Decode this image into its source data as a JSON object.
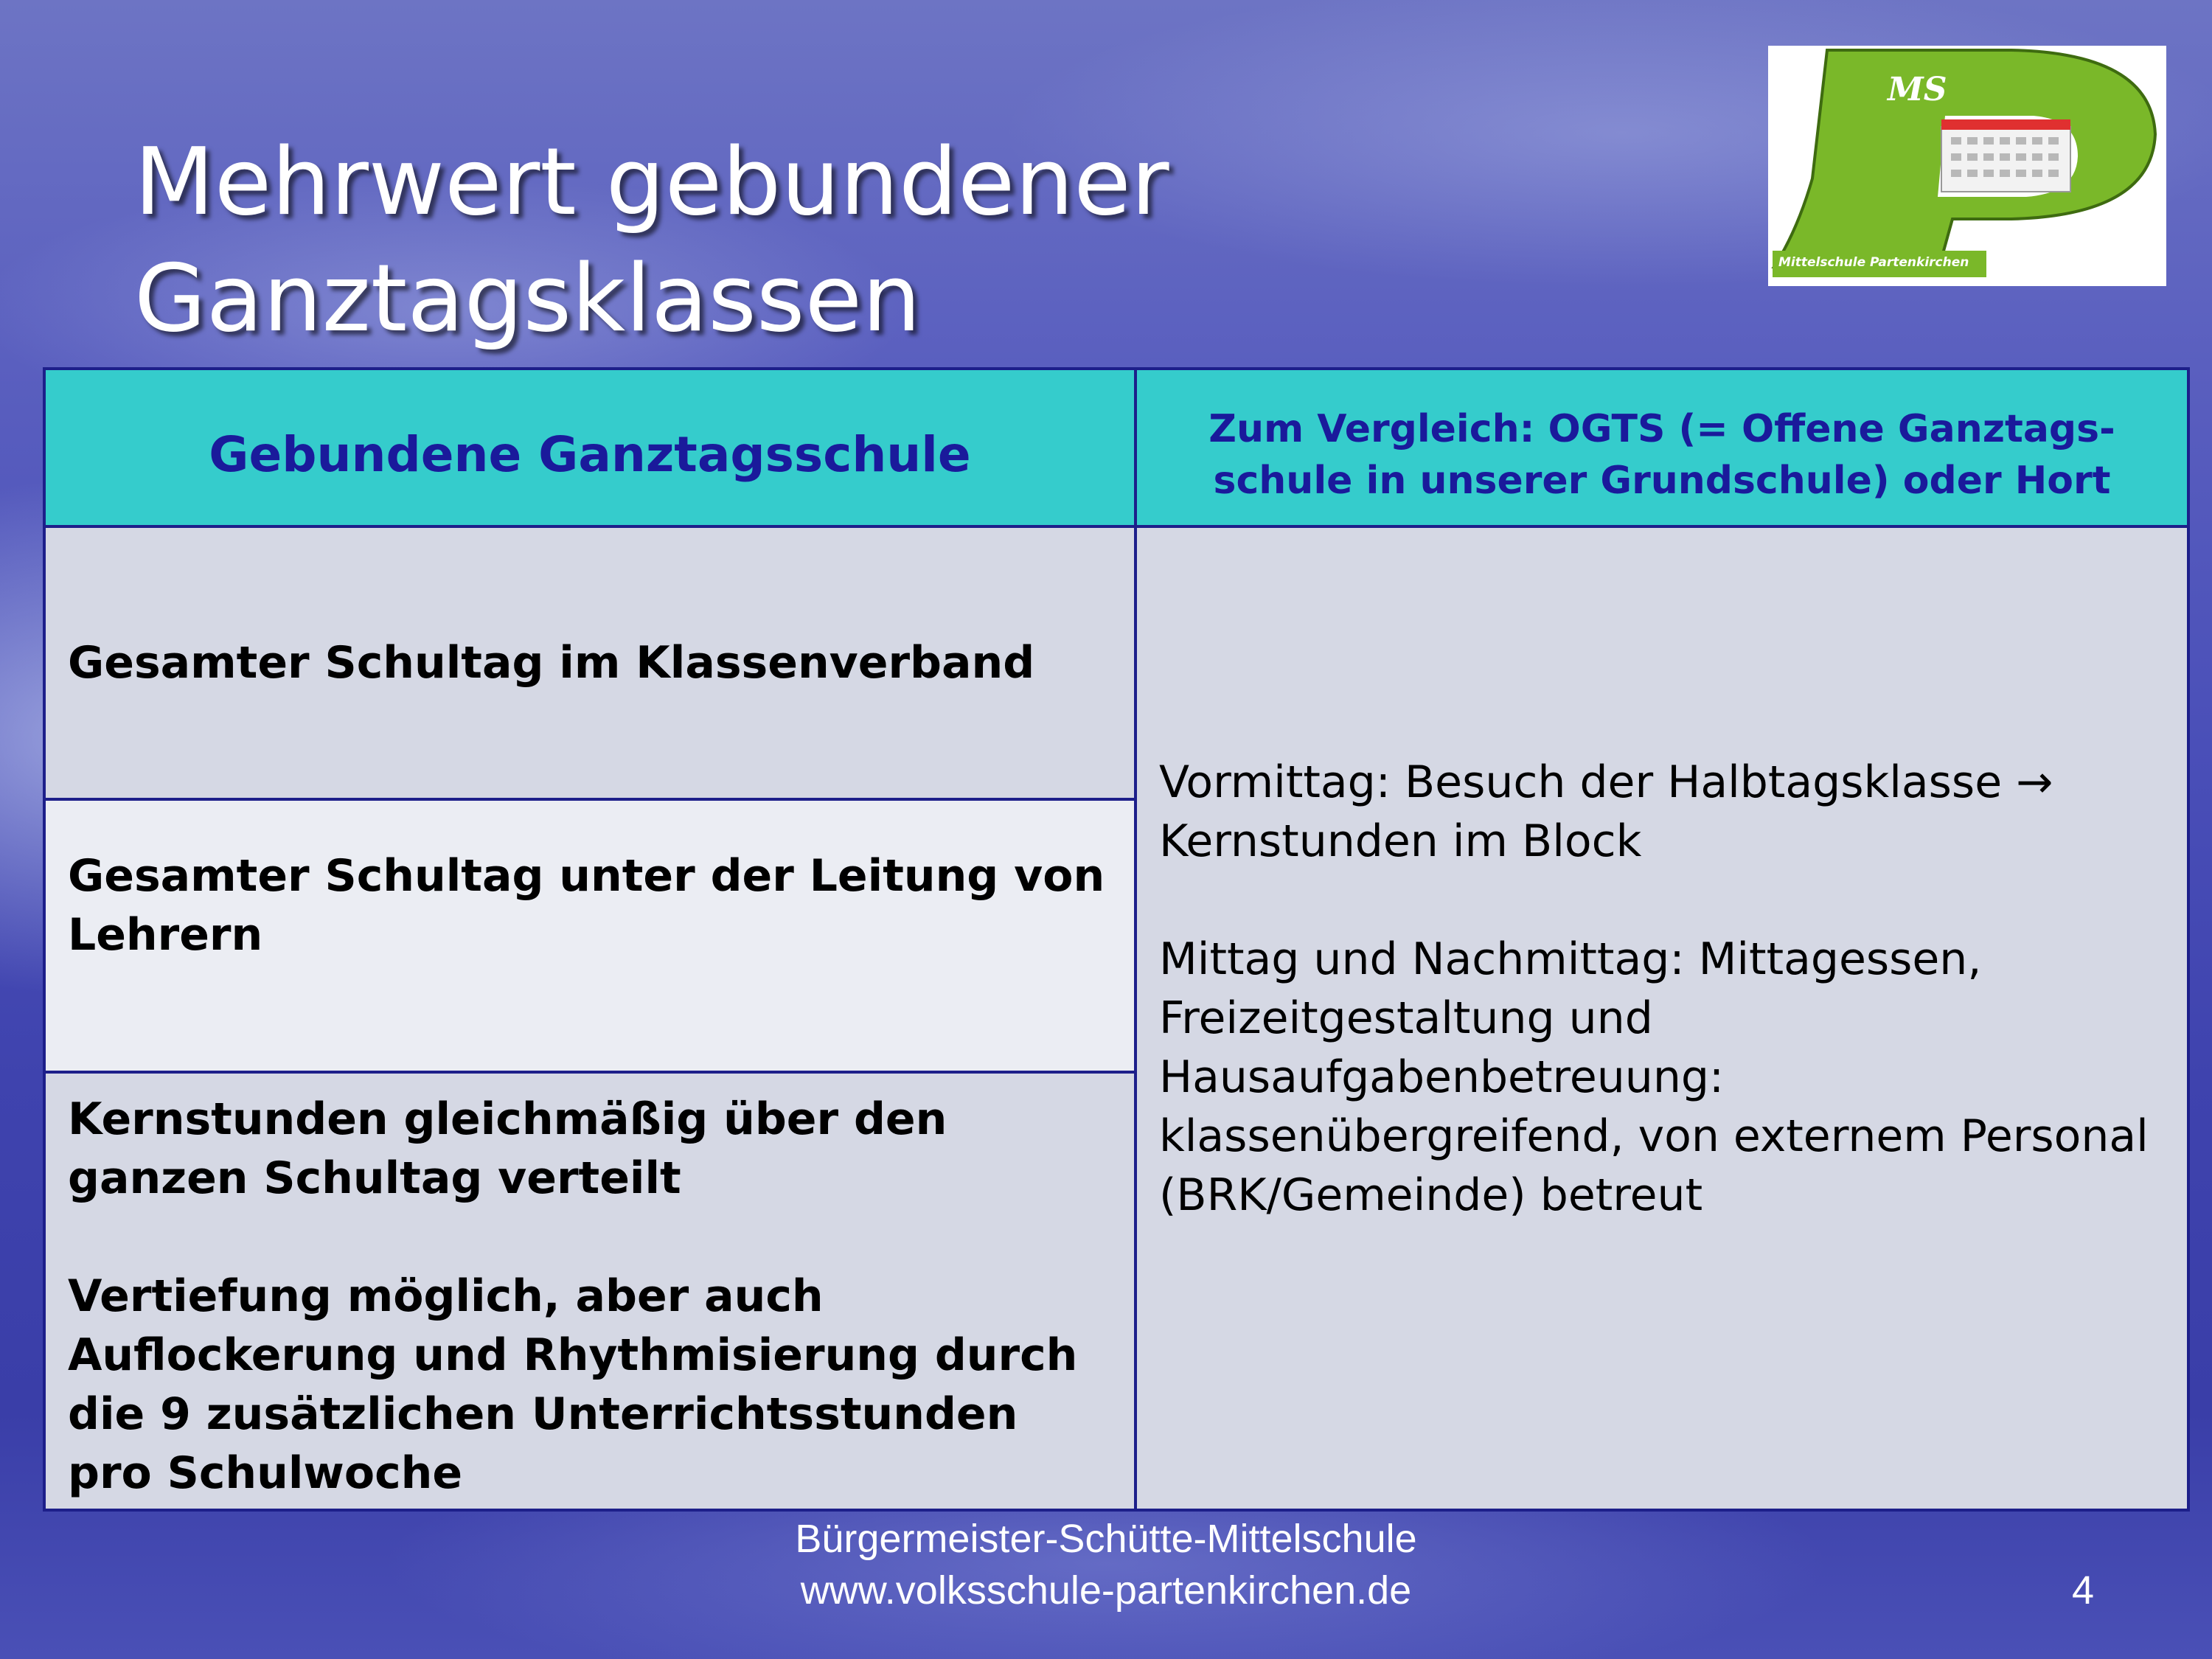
{
  "slide": {
    "title_line1": "Mehrwert gebundener",
    "title_line2": "Ganztagsklassen",
    "page_number": "4"
  },
  "logo": {
    "letters": "MS",
    "caption": "Mittelschule Partenkirchen",
    "colors": {
      "green": "#7ab829",
      "red": "#e03030",
      "text": "#ffffff"
    }
  },
  "table": {
    "header_left": "Gebundene Ganztagsschule",
    "header_right_line1": "Zum Vergleich: OGTS (= Offene Ganztags-",
    "header_right_line2": "schule in unserer Grundschule) oder Hort",
    "rows_left": [
      {
        "text": "Gesamter Schultag im Klassenverband"
      },
      {
        "text": "Gesamter Schultag unter der Leitung von Lehrern"
      },
      {
        "para1": "Kernstunden gleichmäßig über den ganzen Schultag verteilt",
        "para2": "Vertiefung möglich, aber auch Auflockerung und Rhythmisierung durch die 9 zusätzlichen Unterrichtsstunden pro Schulwoche"
      }
    ],
    "right_cell": {
      "para1": "Vormittag: Besuch der Halbtagsklasse → Kernstunden im Block",
      "para2": "Mittag und Nachmittag: Mittagessen, Freizeitgestaltung und Hausaufgabenbetreuung: klassenübergreifend, von externem Personal (BRK/Gemeinde) betreut"
    },
    "colors": {
      "header_bg": "#35cccc",
      "header_text": "#1a1a9b",
      "border": "#1d1f8a",
      "cell_bg": "#d5d8e4",
      "cell_bg_alt": "#ebedf3"
    }
  },
  "footer": {
    "line1": "Bürgermeister-Schütte-Mittelschule",
    "line2": "www.volksschule-partenkirchen.de"
  }
}
